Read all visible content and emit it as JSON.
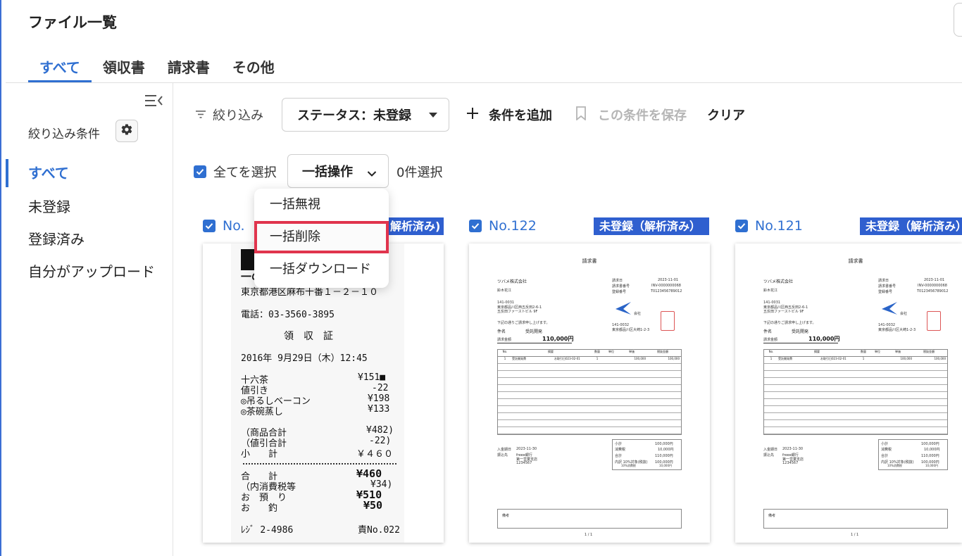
{
  "page": {
    "title": "ファイル一覧"
  },
  "tabs": [
    "すべて",
    "領収書",
    "請求書",
    "その他"
  ],
  "sidebar": {
    "filter_label": "絞り込み条件",
    "items": [
      "すべて",
      "未登録",
      "登録済み",
      "自分がアップロード"
    ]
  },
  "toolbar": {
    "filter_label": "絞り込み",
    "status_filter": "ステータス：未登録",
    "add_condition": "条件を追加",
    "save_condition": "この条件を保存",
    "clear": "クリア"
  },
  "selection": {
    "select_all_label": "全てを選択",
    "bulk_action_label": "一括操作",
    "selected_count": "0件選択"
  },
  "bulk_menu": {
    "items": [
      "一括無視",
      "一括削除",
      "一括ダウンロード"
    ],
    "highlighted": "一括削除"
  },
  "cards": [
    {
      "number": "No.",
      "badge": "解析済み)"
    },
    {
      "number": "No.122",
      "badge": "未登録（解析済み）"
    },
    {
      "number": "No.121",
      "badge": "未登録（解析済み）"
    }
  ],
  "receipt": {
    "lines": [
      "一の",
      "東京都港区麻布十番１－２－１０",
      "電話：03-3560-3895",
      "領　収　証",
      "2016年 9月29日（木）12:45",
      "十六茶",
      "¥151■",
      "値引き",
      "-22",
      "◎吊るしベーコン",
      "¥198",
      "◎茶碗蒸し",
      "¥133",
      "（商品合計",
      "¥482)",
      "（値引合計",
      "-22)",
      "小　　計",
      "￥４６０",
      "合　　計",
      "¥460",
      "（内消費税等",
      "¥34)",
      "お　預　り",
      "¥510",
      "お　　釣",
      "¥50",
      "ﾚｼﾞ 2-4986",
      "責No.022"
    ]
  },
  "invoice": {
    "title": "請求書",
    "company": "ツバメ株式会社",
    "person": "鈴木花江",
    "address": "141-0031",
    "address2": "東京都品川区西五反田2-6-1",
    "address3": "五反田ファーストビル 9F",
    "note": "下記の通りご請求申し上げます。",
    "subject_label": "件名",
    "subject": "受託開発",
    "amount_label": "請求金額",
    "amount": "110,000円",
    "date_label": "請求日",
    "date": "2023-11-01",
    "no_label": "請求書番号",
    "no": "INV-0000000068",
    "reg_label": "登録番号",
    "reg": "T0123456789012",
    "issuer": "会社",
    "issuer_zip": "141-0032",
    "issuer_addr": "東京都品川区大崎1-2-3",
    "table_headers": [
      "No.",
      "摘要",
      "数量",
      "単位",
      "単価",
      "税抜金額"
    ],
    "row": [
      "1",
      "受託開発費",
      "お取引日023-02-01",
      "1",
      "100,000",
      "100,000"
    ],
    "subtotal_label": "小計",
    "subtotal": "100,000円",
    "tax_label": "消費税",
    "tax": "10,000円",
    "total_label": "合計",
    "total": "110,000円",
    "breakdown_label": "内訳 10%対象(税抜)",
    "breakdown": "100,000円",
    "breakdown2_label": "10%消費税",
    "breakdown2": "10,000円",
    "due_label": "入金期日",
    "due": "2023-11-30",
    "bank_label": "振込先",
    "bank": "freee銀行",
    "bank2": "第一営業支店",
    "bank3": "1234567",
    "remarks_label": "備考",
    "page": "1 / 1"
  },
  "colors": {
    "accent": "#2f6fd1",
    "badge": "#2f5fcf",
    "highlight_border": "#e0344d"
  }
}
